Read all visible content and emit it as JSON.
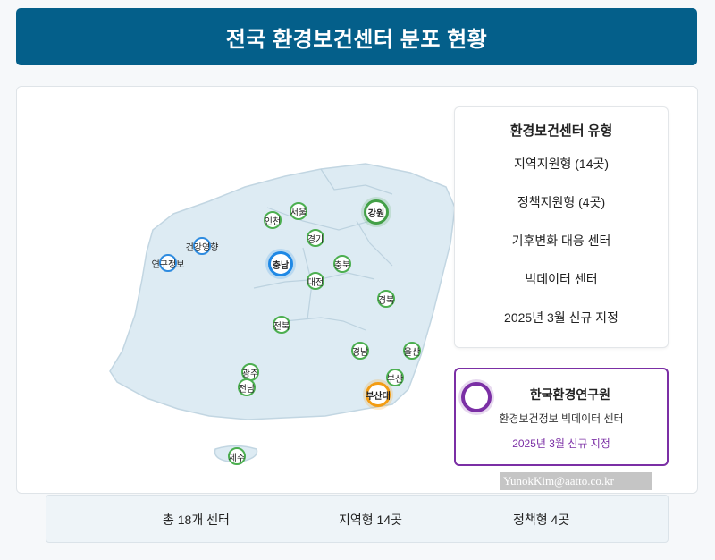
{
  "title": "전국 환경보건센터 분포 현황",
  "legend": {
    "title": "환경보건센터 유형",
    "items": [
      "지역지원형 (14곳)",
      "정책지원형 (4곳)",
      "기후변화 대응 센터",
      "빅데이터 센터",
      "2025년 3월 신규 지정"
    ]
  },
  "research": {
    "name": "한국환경연구원",
    "desc": "환경보건정보 빅데이터 센터",
    "date": "2025년 3월 신규 지정"
  },
  "watermark": "YunokKim@aatto.co.kr",
  "summary": {
    "total": "총 18개 센터",
    "regional": "지역형 14곳",
    "policy": "정책형 4곳"
  },
  "markers": [
    {
      "label": "인천",
      "type": "regional"
    },
    {
      "label": "서울",
      "type": "regional"
    },
    {
      "label": "강원",
      "type": "regional-major"
    },
    {
      "label": "경기",
      "type": "regional"
    },
    {
      "label": "건강영향",
      "type": "policy"
    },
    {
      "label": "연구정보",
      "type": "policy"
    },
    {
      "label": "충남",
      "type": "policy-major"
    },
    {
      "label": "충북",
      "type": "regional"
    },
    {
      "label": "대전",
      "type": "regional"
    },
    {
      "label": "경북",
      "type": "regional"
    },
    {
      "label": "전북",
      "type": "regional"
    },
    {
      "label": "경남",
      "type": "regional"
    },
    {
      "label": "울산",
      "type": "regional"
    },
    {
      "label": "광주",
      "type": "regional"
    },
    {
      "label": "전남",
      "type": "regional"
    },
    {
      "label": "부산",
      "type": "regional"
    },
    {
      "label": "부산대",
      "type": "climate"
    },
    {
      "label": "제주",
      "type": "regional"
    }
  ],
  "colors": {
    "header_bg": "#045f8a",
    "regional": "#4caf50",
    "policy": "#2d8be0",
    "climate": "#f39c12",
    "bigdata": "#7b2fa5"
  }
}
